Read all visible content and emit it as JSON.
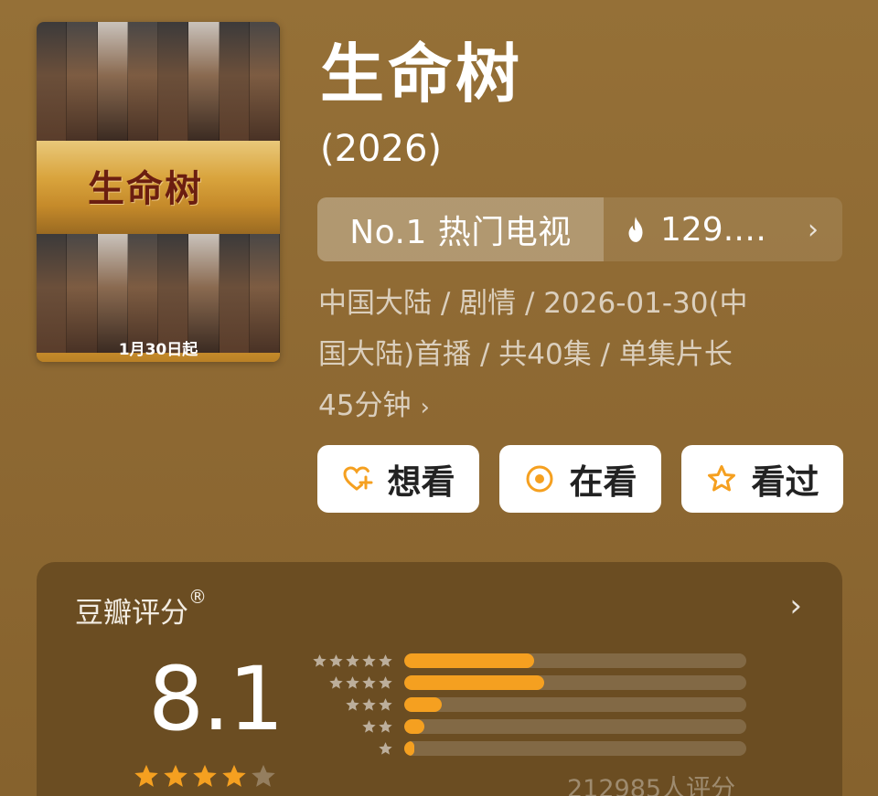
{
  "show": {
    "title": "生命树",
    "year": "(2026)"
  },
  "poster": {
    "title_art": "生命树",
    "date_text": "1月30日起"
  },
  "rank": {
    "label": "No.1 热门电视",
    "hot_value": "129.…"
  },
  "meta": {
    "line1": "中国大陆 / 剧情 / 2026-01-30(中",
    "line2": "国大陆)首播 / 共40集 / 单集片长",
    "line3": "45分钟"
  },
  "actions": [
    {
      "label": "想看",
      "icon": "heart-plus-icon"
    },
    {
      "label": "在看",
      "icon": "target-circle-icon"
    },
    {
      "label": "看过",
      "icon": "star-outline-icon"
    }
  ],
  "rating": {
    "title": "豆瓣评分",
    "trademark": "®",
    "score": "8.1",
    "stars": 4,
    "count_text": "212985人评分",
    "distribution": [
      {
        "stars": 5,
        "fraction": 0.38
      },
      {
        "stars": 4,
        "fraction": 0.41
      },
      {
        "stars": 3,
        "fraction": 0.11
      },
      {
        "stars": 2,
        "fraction": 0.06
      },
      {
        "stars": 1,
        "fraction": 0.03
      }
    ]
  },
  "colors": {
    "background": "#8f6a33",
    "card": "#6b4d22",
    "accent_orange": "#f5a020",
    "button_bg": "#ffffff"
  }
}
